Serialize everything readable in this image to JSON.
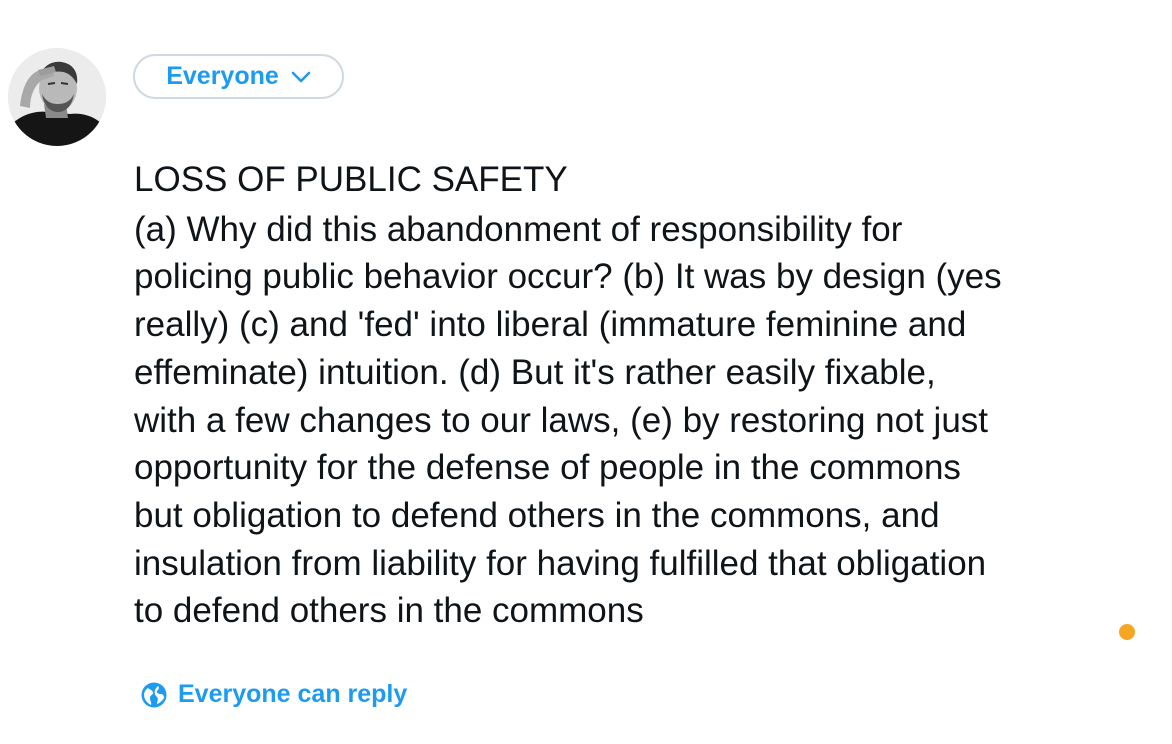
{
  "audience": {
    "label": "Everyone",
    "icon": "chevron-down-icon"
  },
  "tweet": {
    "heading": "LOSS OF PUBLIC SAFETY",
    "body": "(a) Why did this abandonment of responsibility for\npolicing public behavior occur? (b) It was by design (yes\nreally) (c) and 'fed' into liberal (immature feminine and\neffeminate) intuition. (d) But it's rather easily fixable,\nwith a few changes to our laws, (e) by restoring not just\nopportunity for the defense of people in the commons\nbut obligation to defend others in the commons, and\ninsulation from liability for having fulfilled that obligation\nto defend others in the commons"
  },
  "reply_setting": {
    "label": "Everyone can reply",
    "icon": "globe-icon"
  },
  "colors": {
    "accent": "#1d9bf0",
    "border": "#cfd9de",
    "text": "#0f1419",
    "char_counter_warning": "#f6a623"
  }
}
